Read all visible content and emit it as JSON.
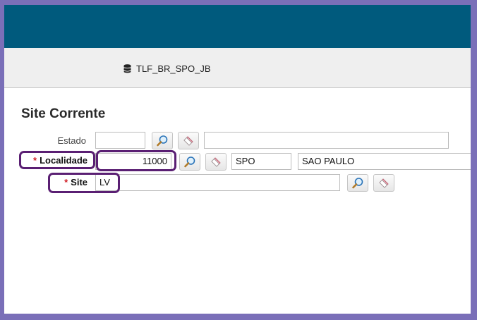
{
  "subheader": {
    "database_icon": "database-icon",
    "connection": "TLF_BR_SPO_JB"
  },
  "form": {
    "title": "Site Corrente",
    "required_mark": "*",
    "estado": {
      "label": "Estado",
      "value": "",
      "description": ""
    },
    "localidade": {
      "label": "Localidade",
      "value": "11000",
      "code": "SPO",
      "description": "SAO PAULO"
    },
    "site": {
      "label": "Site",
      "value": "LV"
    }
  },
  "icons": {
    "search": "magnifier-icon",
    "clear": "eraser-icon"
  },
  "colors": {
    "topbar": "#005a7d",
    "required": "#d2232a",
    "highlight": "#5a1f73"
  }
}
